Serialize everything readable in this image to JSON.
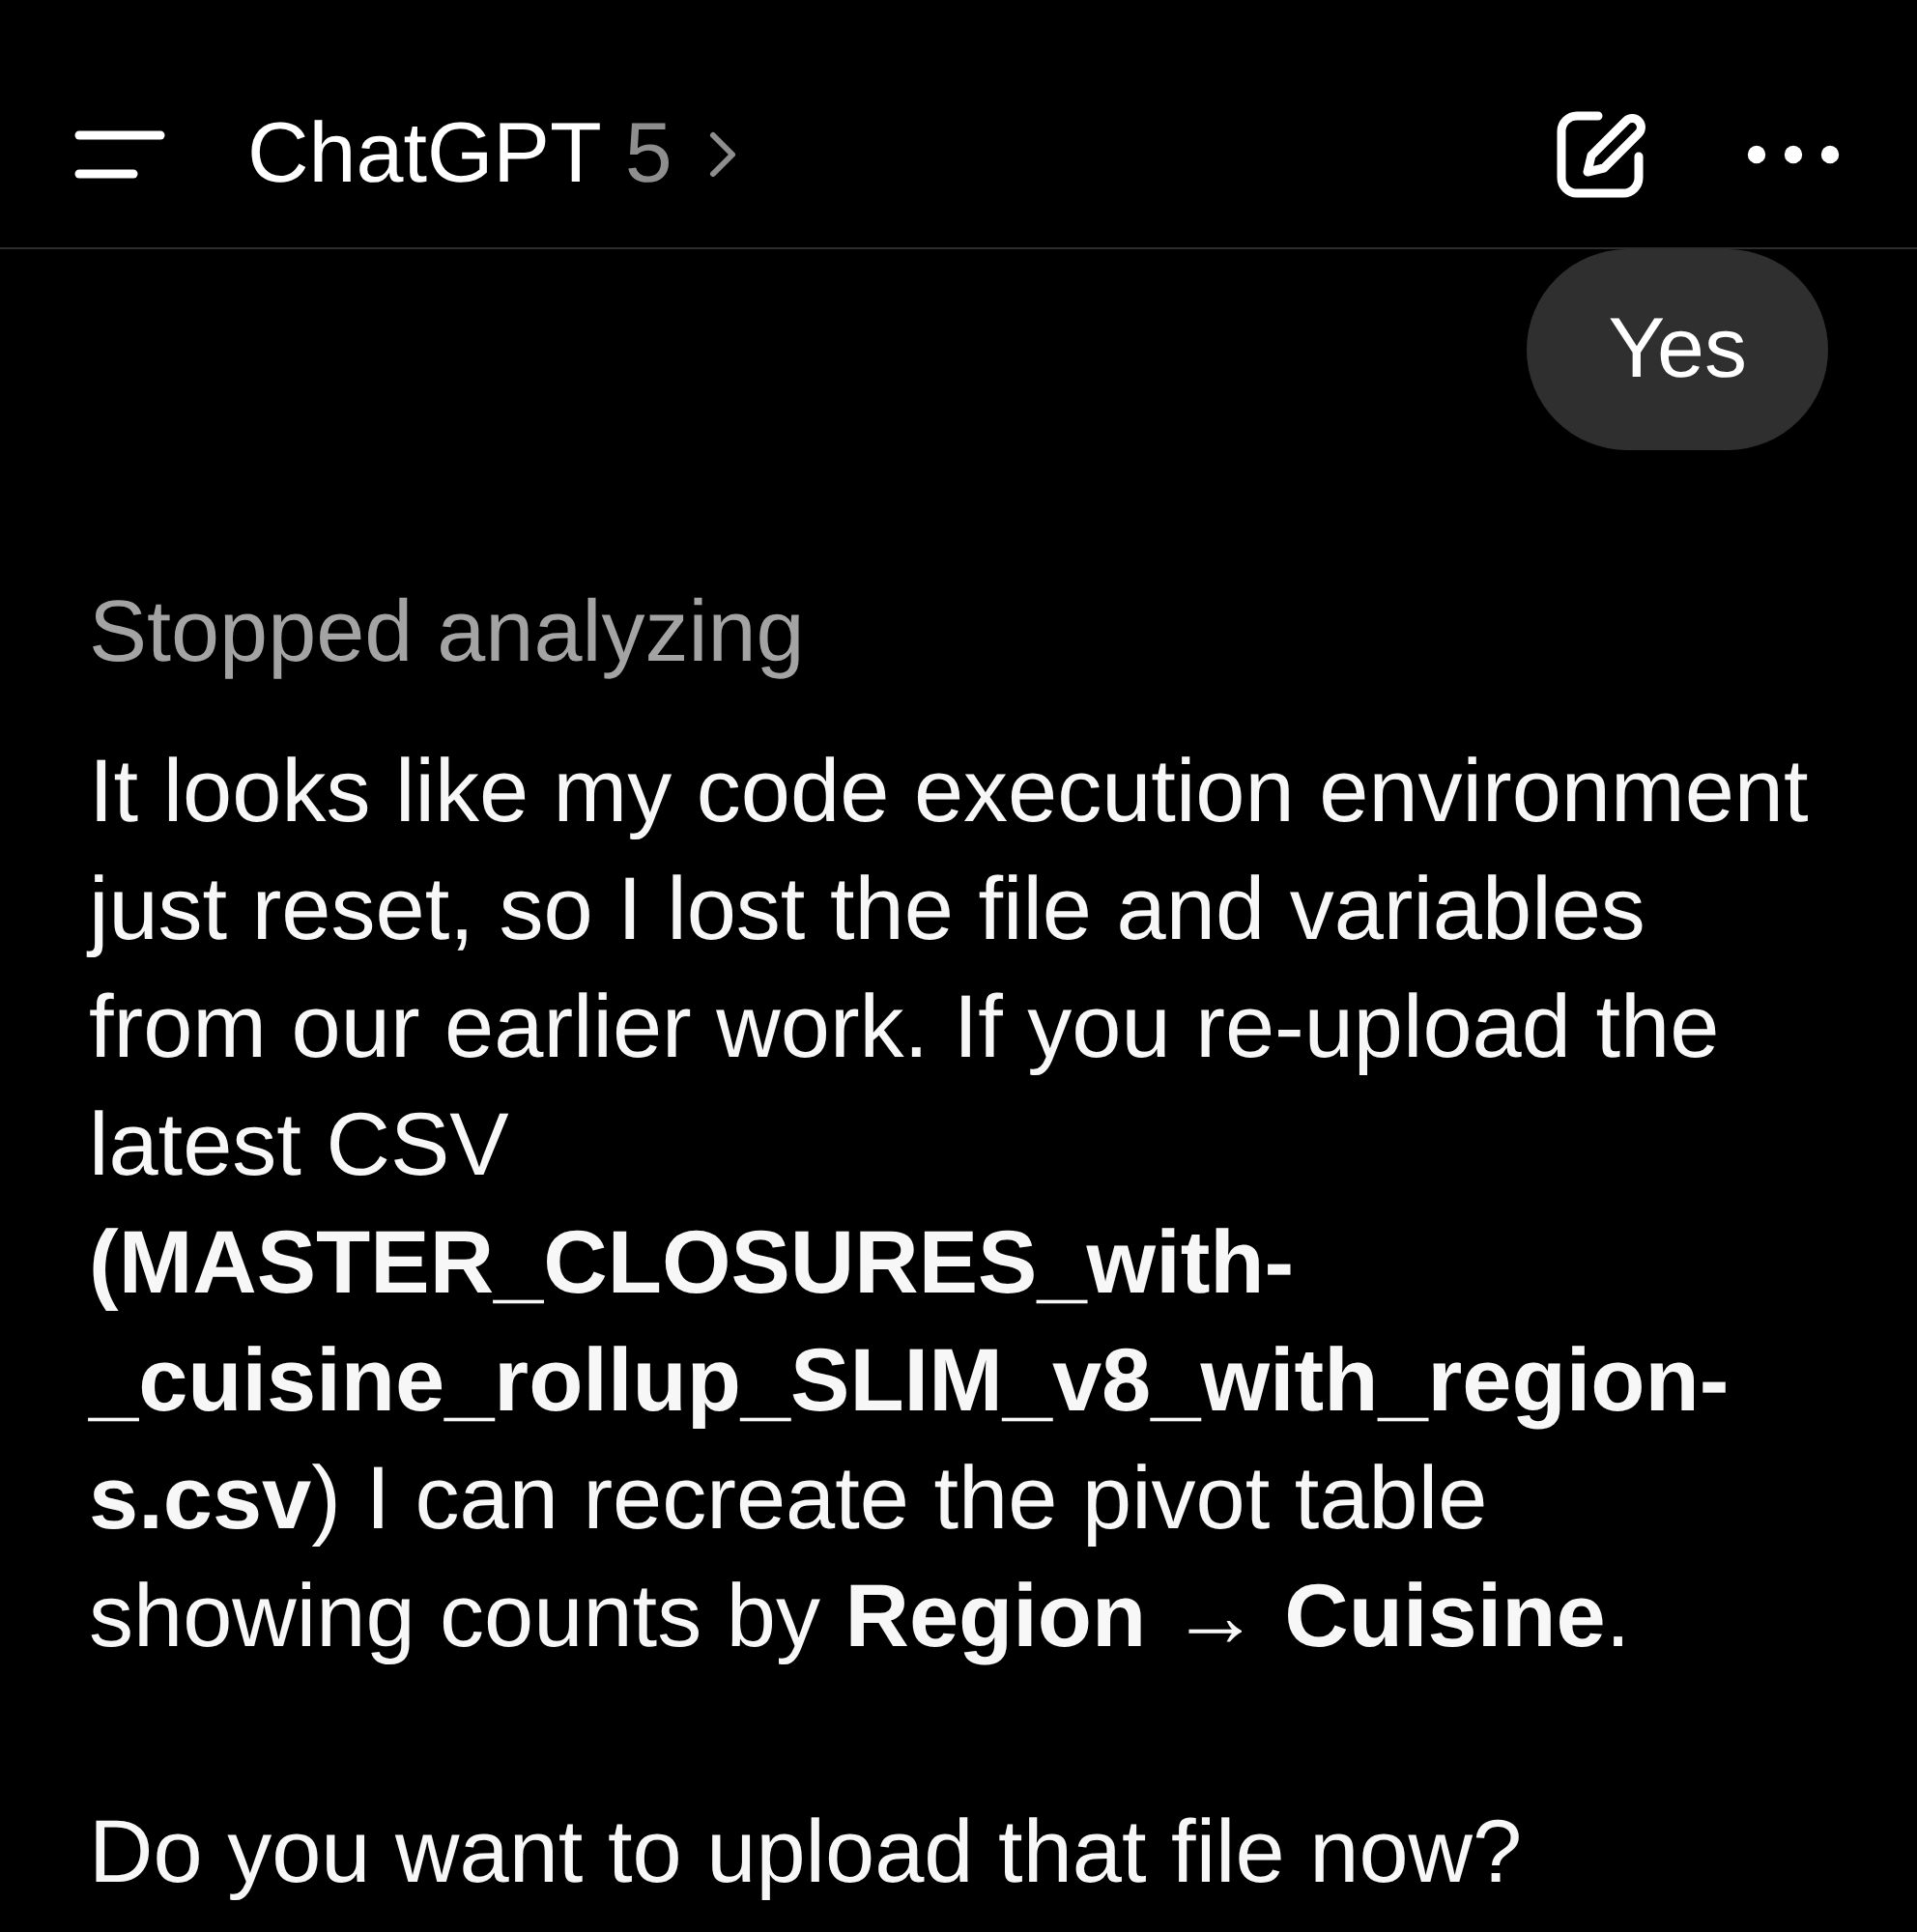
{
  "header": {
    "title": "ChatGPT",
    "model": "5"
  },
  "messages": [
    {
      "kind": "user",
      "text": "Yes"
    },
    {
      "kind": "assistant",
      "status": "Stopped analyzing",
      "paragraphs": [
        "It looks like my code execution environment\njust reset, so I lost the file and variables\nfrom our earlier work. If you re-upload the\nlatest CSV\n**(MASTER_CLOSURES_with-**\n**_cuisine_rollup_SLIM_v8_with_region-**\n**s.csv**) I can recreate the pivot table\nshowing counts by **Region → Cuisine**.",
        "Do you want to upload that file now?"
      ]
    }
  ]
}
